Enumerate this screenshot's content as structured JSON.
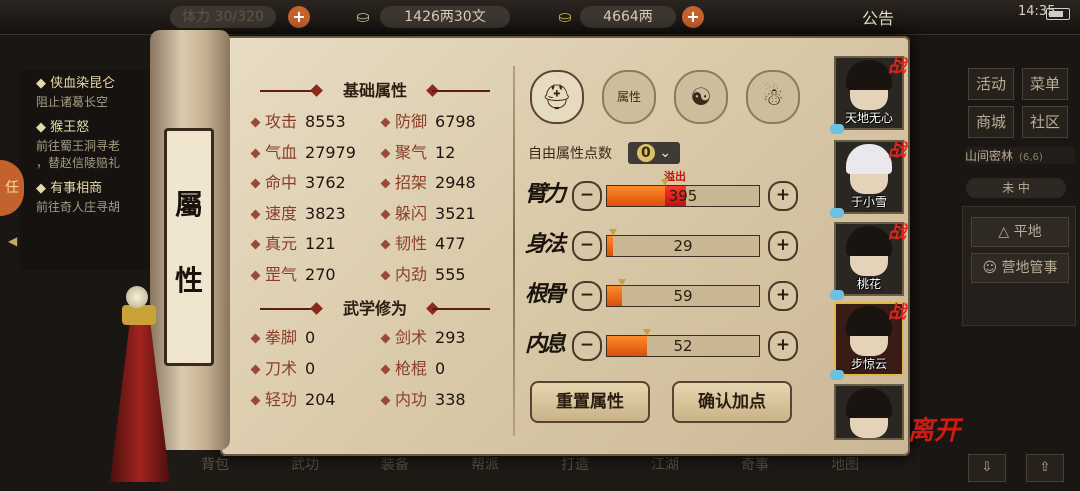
{
  "topbar": {
    "stamina": "30/320",
    "stamina_prefix": "体力",
    "money_silver": "1426两30文",
    "money_gold": "4664两",
    "announcement": "公告",
    "clock": "14:35"
  },
  "quests": [
    {
      "title": "侠血染昆仑",
      "desc": "阻止诸葛长空"
    },
    {
      "title": "猴王怒",
      "desc": "前往蜀王洞寻老",
      "desc2": "，替赵信陵赔礼"
    },
    {
      "title": "有事相商",
      "desc": "前往奇人庄寻胡"
    }
  ],
  "quest_tab_label": "任",
  "scroll_tab": {
    "label_top": "屬",
    "label_bottom": "性"
  },
  "basic_section": {
    "title": "基础属性",
    "stats": [
      {
        "label": "攻击",
        "value": "8553"
      },
      {
        "label": "防御",
        "value": "6798"
      },
      {
        "label": "气血",
        "value": "27979"
      },
      {
        "label": "聚气",
        "value": "12"
      },
      {
        "label": "命中",
        "value": "3762"
      },
      {
        "label": "招架",
        "value": "2948"
      },
      {
        "label": "速度",
        "value": "3823"
      },
      {
        "label": "躲闪",
        "value": "3521"
      },
      {
        "label": "真元",
        "value": "121"
      },
      {
        "label": "韧性",
        "value": "477"
      },
      {
        "label": "罡气",
        "value": "270"
      },
      {
        "label": "内劲",
        "value": "555"
      }
    ]
  },
  "martial_section": {
    "title": "武学修为",
    "stats": [
      {
        "label": "拳脚",
        "value": "0"
      },
      {
        "label": "剑术",
        "value": "293"
      },
      {
        "label": "刀术",
        "value": "0"
      },
      {
        "label": "枪棍",
        "value": "0"
      },
      {
        "label": "轻功",
        "value": "204"
      },
      {
        "label": "内功",
        "value": "338"
      }
    ]
  },
  "icon_tabs": [
    {
      "name": "hat-icon",
      "glyph": "⛑"
    },
    {
      "name": "scroll-attr-icon",
      "glyph": "属性"
    },
    {
      "name": "bagua-icon",
      "glyph": "☯"
    },
    {
      "name": "meridian-icon",
      "glyph": "☃"
    }
  ],
  "free_points": {
    "label": "自由属性点数",
    "value": "0"
  },
  "overflow_label": "溢出",
  "attributes": [
    {
      "label": "臂力",
      "value": "395",
      "level": 0.38,
      "overflow": 0.14
    },
    {
      "label": "身法",
      "value": "29",
      "level": 0.04,
      "overflow": 0
    },
    {
      "label": "根骨",
      "value": "59",
      "level": 0.1,
      "overflow": 0
    },
    {
      "label": "内息",
      "value": "52",
      "level": 0.26,
      "overflow": 0
    }
  ],
  "buttons": {
    "reset": "重置属性",
    "confirm": "确认加点"
  },
  "party": [
    {
      "name": "天地无心",
      "war": "战"
    },
    {
      "name": "于小雪",
      "war": "战"
    },
    {
      "name": "桃花",
      "war": "战"
    },
    {
      "name": "步惊云",
      "war": "战"
    },
    {
      "name": "",
      "war": ""
    }
  ],
  "leave": "离开",
  "right_menu": {
    "buttons": [
      "活动",
      "菜单",
      "商城",
      "社区"
    ],
    "map": "山间密林",
    "coord": "(6,6)",
    "weather": "未 中",
    "sub": [
      "平地",
      "营地管事"
    ]
  },
  "dock": [
    "背包",
    "武功",
    "装备",
    "帮派",
    "打造",
    "江湖",
    "奇事",
    "地图"
  ]
}
